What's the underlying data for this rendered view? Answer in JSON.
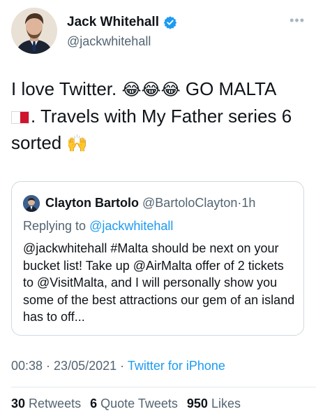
{
  "author": {
    "display_name": "Jack Whitehall",
    "handle": "@jackwhitehall",
    "verified_icon": "verified-badge-icon",
    "more_glyph": "•••"
  },
  "tweet": {
    "line1_text": "I love Twitter. ",
    "line1_emoji": "😂😂😂",
    "line1_tail": " GO MALTA",
    "line2_text": ". Travels with My Father series 6",
    "line3_text": "sorted ",
    "line3_emoji": "🙌",
    "flag_icon": "malta-flag-icon"
  },
  "quoted_tweet": {
    "display_name": "Clayton Bartolo",
    "handle": "@BartoloClayton",
    "separator": "·",
    "time": "1h",
    "replying_prefix": "Replying to ",
    "replying_to": "@jackwhitehall",
    "text": "@jackwhitehall #Malta should be next on your bucket list! Take up @AirMalta offer of 2 tickets to @VisitMalta, and I will personally show you some of the best attractions our gem of an island has to off..."
  },
  "meta": {
    "time": "00:38",
    "separator": " · ",
    "date": "23/05/2021",
    "source": "Twitter for iPhone"
  },
  "stats": {
    "retweets_count": "30",
    "retweets_label": "Retweets",
    "quotes_count": "6",
    "quotes_label": "Quote Tweets",
    "likes_count": "950",
    "likes_label": "Likes"
  },
  "colors": {
    "link": "#1d9bf0",
    "secondary_text": "#536471",
    "primary_text": "#0f1419",
    "border": "#cfd9de"
  }
}
